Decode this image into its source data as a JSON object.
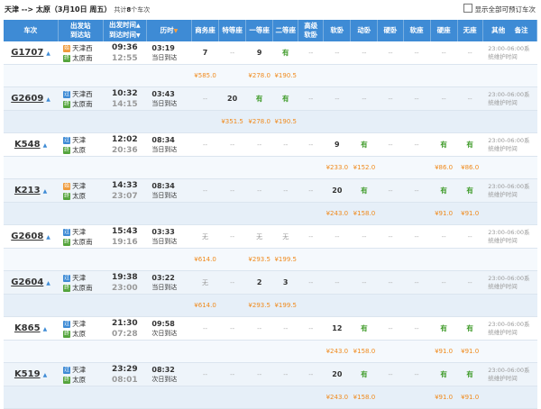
{
  "header": {
    "route": "天津 --> 太原（3月10日 周五）",
    "count_prefix": "共计",
    "count": "8",
    "count_suffix": "个车次",
    "show_all_label": "显示全部可预订车次"
  },
  "columns": {
    "train_no": "车次",
    "station_1": "出发站",
    "station_2": "到达站",
    "time_1": "出发时间",
    "time_2": "到达时间",
    "duration": "历时",
    "business": "商务座",
    "special": "特等座",
    "first": "一等座",
    "second": "二等座",
    "soft_1": "高级",
    "soft_2": "软卧",
    "soft_sleeper": "软卧",
    "dongwo": "动卧",
    "hard_sleeper": "硬卧",
    "soft_seat": "软座",
    "hard_seat": "硬座",
    "no_seat": "无座",
    "other": "其他",
    "remark": "备注"
  },
  "status": {
    "dash": "--",
    "have": "有",
    "none": "无",
    "note_1": "23:00-06:00系",
    "note_2": "统维护时间"
  },
  "trains": [
    {
      "no": "G1707",
      "from": "天津西",
      "from_type": "始",
      "to": "太原南",
      "to_type": "终",
      "dep": "09:36",
      "arr": "12:55",
      "dur": "03:19",
      "arrive_day": "当日到达",
      "seats": [
        "7",
        "--",
        "9",
        "有",
        "--",
        "--",
        "--",
        "--",
        "--",
        "--",
        "--",
        "--",
        "--"
      ],
      "prices": [
        "¥585.0",
        "",
        "¥278.0",
        "¥190.5",
        "",
        "",
        "",
        "",
        "",
        "",
        "",
        "",
        ""
      ]
    },
    {
      "no": "G2609",
      "from": "天津西",
      "from_type": "过",
      "to": "太原南",
      "to_type": "终",
      "dep": "10:32",
      "arr": "14:15",
      "dur": "03:43",
      "arrive_day": "当日到达",
      "seats": [
        "--",
        "20",
        "有",
        "有",
        "--",
        "--",
        "--",
        "--",
        "--",
        "--",
        "--",
        "--",
        "--"
      ],
      "prices": [
        "",
        "¥351.5",
        "¥278.0",
        "¥190.5",
        "",
        "",
        "",
        "",
        "",
        "",
        "",
        "",
        ""
      ]
    },
    {
      "no": "K548",
      "from": "天津",
      "from_type": "过",
      "to": "太原",
      "to_type": "终",
      "dep": "12:02",
      "arr": "20:36",
      "dur": "08:34",
      "arrive_day": "当日到达",
      "seats": [
        "--",
        "--",
        "--",
        "--",
        "--",
        "9",
        "有",
        "--",
        "--",
        "有",
        "有",
        "--",
        "--"
      ],
      "prices": [
        "",
        "",
        "",
        "",
        "",
        "¥233.0",
        "¥152.0",
        "",
        "",
        "¥86.0",
        "¥86.0",
        "",
        ""
      ]
    },
    {
      "no": "K213",
      "from": "天津",
      "from_type": "始",
      "to": "太原",
      "to_type": "终",
      "dep": "14:33",
      "arr": "23:07",
      "dur": "08:34",
      "arrive_day": "当日到达",
      "seats": [
        "--",
        "--",
        "--",
        "--",
        "--",
        "20",
        "有",
        "--",
        "--",
        "有",
        "有",
        "--",
        "--"
      ],
      "prices": [
        "",
        "",
        "",
        "",
        "",
        "¥243.0",
        "¥158.0",
        "",
        "",
        "¥91.0",
        "¥91.0",
        "",
        ""
      ]
    },
    {
      "no": "G2608",
      "from": "天津",
      "from_type": "过",
      "to": "太原南",
      "to_type": "终",
      "dep": "15:43",
      "arr": "19:16",
      "dur": "03:33",
      "arrive_day": "当日到达",
      "seats": [
        "无",
        "--",
        "无",
        "无",
        "--",
        "--",
        "--",
        "--",
        "--",
        "--",
        "--",
        "--",
        "--"
      ],
      "prices": [
        "¥614.0",
        "",
        "¥293.5",
        "¥199.5",
        "",
        "",
        "",
        "",
        "",
        "",
        "",
        "",
        ""
      ]
    },
    {
      "no": "G2604",
      "from": "天津",
      "from_type": "过",
      "to": "太原南",
      "to_type": "终",
      "dep": "19:38",
      "arr": "23:00",
      "dur": "03:22",
      "arrive_day": "当日到达",
      "seats": [
        "无",
        "--",
        "2",
        "3",
        "--",
        "--",
        "--",
        "--",
        "--",
        "--",
        "--",
        "--",
        "--"
      ],
      "prices": [
        "¥614.0",
        "",
        "¥293.5",
        "¥199.5",
        "",
        "",
        "",
        "",
        "",
        "",
        "",
        "",
        ""
      ]
    },
    {
      "no": "K865",
      "from": "天津",
      "from_type": "过",
      "to": "太原",
      "to_type": "终",
      "dep": "21:30",
      "arr": "07:28",
      "dur": "09:58",
      "arrive_day": "次日到达",
      "seats": [
        "--",
        "--",
        "--",
        "--",
        "--",
        "12",
        "有",
        "--",
        "--",
        "有",
        "有",
        "--",
        "--"
      ],
      "prices": [
        "",
        "",
        "",
        "",
        "",
        "¥243.0",
        "¥158.0",
        "",
        "",
        "¥91.0",
        "¥91.0",
        "",
        ""
      ]
    },
    {
      "no": "K519",
      "from": "天津",
      "from_type": "过",
      "to": "太原",
      "to_type": "终",
      "dep": "23:29",
      "arr": "08:01",
      "dur": "08:32",
      "arrive_day": "次日到达",
      "seats": [
        "--",
        "--",
        "--",
        "--",
        "--",
        "20",
        "有",
        "--",
        "--",
        "有",
        "有",
        "--",
        "--"
      ],
      "prices": [
        "",
        "",
        "",
        "",
        "",
        "¥243.0",
        "¥158.0",
        "",
        "",
        "¥91.0",
        "¥91.0",
        "",
        ""
      ]
    }
  ]
}
